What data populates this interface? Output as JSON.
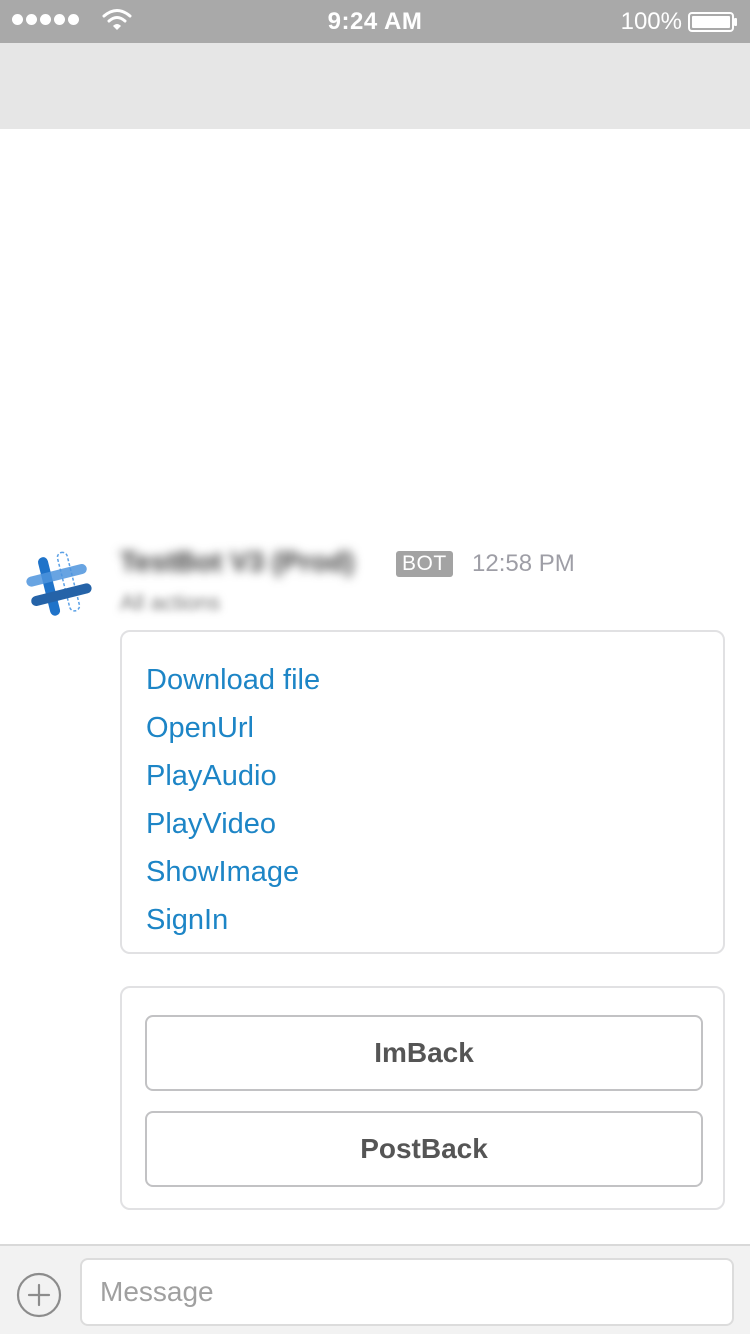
{
  "status_bar": {
    "time": "9:24 AM",
    "battery_percent": "100%",
    "signal_bars": 5,
    "icons": [
      "signal-dots-icon",
      "wifi-icon",
      "battery-icon"
    ]
  },
  "message": {
    "sender": "TestBot V3 (Prod)",
    "badge": "BOT",
    "time": "12:58 PM",
    "subtitle": "All actions",
    "avatar_icon": "slack-hash-icon"
  },
  "links_card": {
    "links": [
      {
        "label": "Download file"
      },
      {
        "label": "OpenUrl"
      },
      {
        "label": "PlayAudio"
      },
      {
        "label": "PlayVideo"
      },
      {
        "label": "ShowImage"
      },
      {
        "label": "SignIn"
      }
    ]
  },
  "buttons_card": {
    "imback_label": "ImBack",
    "postback_label": "PostBack"
  },
  "composer": {
    "placeholder": "Message",
    "value": "",
    "plus_icon": "plus-circle-icon"
  },
  "colors": {
    "link": "#1d85c6",
    "status_bar": "#a9a9a9",
    "header": "#e6e6e6",
    "badge": "#a3a3a3"
  }
}
